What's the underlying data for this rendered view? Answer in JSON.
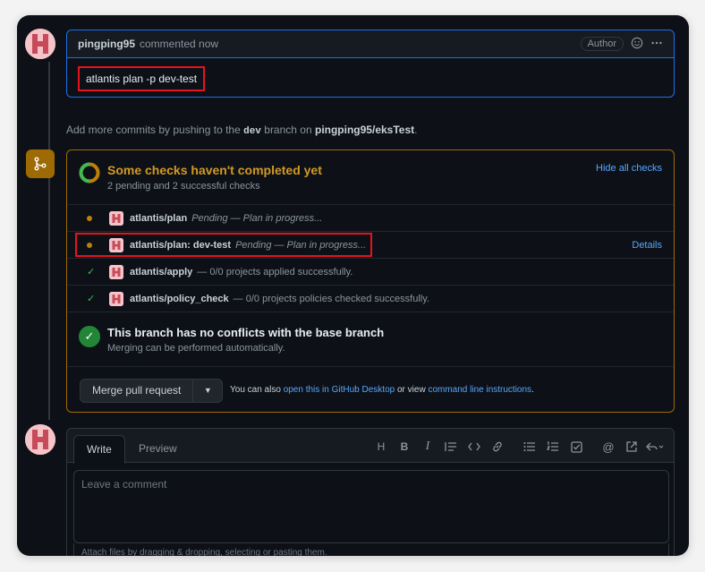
{
  "comment": {
    "author": "pingping95",
    "meta": "commented now",
    "badge": "Author",
    "body": "atlantis plan -p dev-test"
  },
  "push_note": {
    "prefix": "Add more commits by pushing to the",
    "branch": "dev",
    "middle": "branch on",
    "repo": "pingping95/eksTest",
    "suffix": "."
  },
  "checks": {
    "title": "Some checks haven't completed yet",
    "subtitle": "2 pending and 2 successful checks",
    "hide_label": "Hide all checks",
    "items": [
      {
        "name": "atlantis/plan",
        "desc": "Pending — Plan in progress...",
        "status": "pending",
        "details": ""
      },
      {
        "name": "atlantis/plan: dev-test",
        "desc": "Pending — Plan in progress...",
        "status": "pending",
        "details": "Details"
      },
      {
        "name": "atlantis/apply",
        "desc": "— 0/0 projects applied successfully.",
        "status": "success",
        "details": ""
      },
      {
        "name": "atlantis/policy_check",
        "desc": "— 0/0 projects policies checked successfully.",
        "status": "success",
        "details": ""
      }
    ]
  },
  "conflict": {
    "title": "This branch has no conflicts with the base branch",
    "subtitle": "Merging can be performed automatically."
  },
  "merge": {
    "button_label": "Merge pull request",
    "hint_prefix": "You can also",
    "desktop_link": "open this in GitHub Desktop",
    "hint_middle": "or view",
    "cli_link": "command line instructions",
    "hint_suffix": "."
  },
  "new_comment": {
    "tab_write": "Write",
    "tab_preview": "Preview",
    "placeholder": "Leave a comment",
    "attach_hint": "Attach files by dragging & dropping, selecting or pasting them."
  },
  "colors": {
    "accent_blue": "#58a6ff",
    "pending_yellow": "#d29922",
    "success_green": "#3fb950",
    "highlight_red": "#e4131f"
  }
}
